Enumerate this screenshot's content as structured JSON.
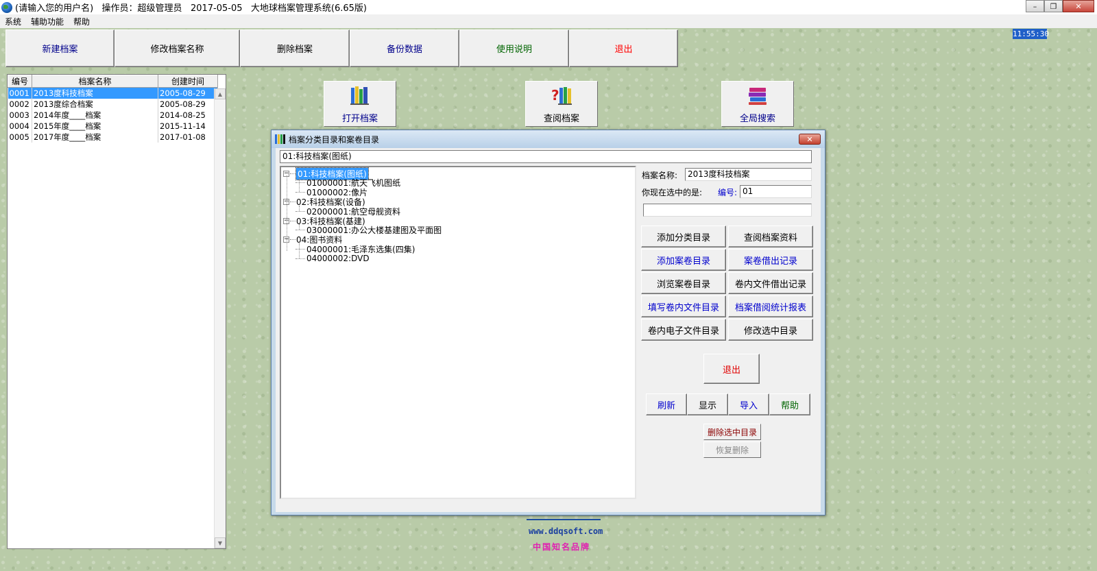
{
  "window": {
    "title": "(请输入您的用户名)   操作员：超级管理员   2017-05-05   大地球档案管理系统(6.65版)"
  },
  "menu": [
    "系统",
    "辅助功能",
    "帮助"
  ],
  "clock": "11:55:30",
  "toolbar": [
    {
      "label": "新建档案",
      "color": "#00008b"
    },
    {
      "label": "修改档案名称",
      "color": "#000000"
    },
    {
      "label": "删除档案",
      "color": "#000000"
    },
    {
      "label": "备份数据",
      "color": "#00008b"
    },
    {
      "label": "使用说明",
      "color": "#006400"
    },
    {
      "label": "退出",
      "color": "#ff0000"
    }
  ],
  "archive_list": {
    "columns": [
      "编号",
      "档案名称",
      "创建时间"
    ],
    "rows": [
      {
        "id": "0001",
        "name": "2013度科技档案",
        "date": "2005-08-29"
      },
      {
        "id": "0002",
        "name": "2013度综合档案",
        "date": "2005-08-29"
      },
      {
        "id": "0003",
        "name": "2014年度____档案",
        "date": "2014-08-25"
      },
      {
        "id": "0004",
        "name": "2015年度____档案",
        "date": "2015-11-14"
      },
      {
        "id": "0005",
        "name": "2017年度____档案",
        "date": "2017-01-08"
      }
    ],
    "selected_index": 0
  },
  "icon_buttons": [
    {
      "label": "打开档案",
      "icon": "books-icon",
      "color": "#00008b"
    },
    {
      "label": "查阅档案",
      "icon": "books-question-icon",
      "color": "#000000"
    },
    {
      "label": "全局搜索",
      "icon": "stacked-books-icon",
      "color": "#00008b"
    }
  ],
  "footer": {
    "url": "www.ddqsoft.com",
    "brand": "中国知名品牌"
  },
  "dialog": {
    "title": "档案分类目录和案卷目录",
    "close": "✕",
    "path": "01:科技档案(图纸)",
    "tree": [
      {
        "text": "01:科技档案(图纸)",
        "level": 0,
        "expander": "−",
        "selected": true
      },
      {
        "text": "01000001:航天飞机图纸",
        "level": 1
      },
      {
        "text": "01000002:像片",
        "level": 1
      },
      {
        "text": "02:科技档案(设备)",
        "level": 0,
        "expander": "−"
      },
      {
        "text": "02000001:航空母舰资料",
        "level": 1
      },
      {
        "text": "03:科技档案(基建)",
        "level": 0,
        "expander": "−"
      },
      {
        "text": "03000001:办公大楼基建图及平面图",
        "level": 1
      },
      {
        "text": "04:图书资料",
        "level": 0,
        "expander": "−"
      },
      {
        "text": "04000001:毛泽东选集(四集)",
        "level": 1
      },
      {
        "text": "04000002:DVD",
        "level": 1
      }
    ],
    "archive_name_label": "档案名称:",
    "archive_name_value": "2013度科技档案",
    "selected_label": "你现在选中的是:",
    "code_label": "编号:",
    "code_value": "01",
    "name_field_value": "",
    "action_buttons": [
      {
        "label": "添加分类目录",
        "color": "#000000"
      },
      {
        "label": "查阅档案资料",
        "color": "#000000"
      },
      {
        "label": "添加案卷目录",
        "color": "#0000cd"
      },
      {
        "label": "案卷借出记录",
        "color": "#0000cd"
      },
      {
        "label": "浏览案卷目录",
        "color": "#000000"
      },
      {
        "label": "卷内文件借出记录",
        "color": "#000000"
      },
      {
        "label": "填写卷内文件目录",
        "color": "#0000cd"
      },
      {
        "label": "档案借阅统计报表",
        "color": "#0000cd"
      },
      {
        "label": "卷内电子文件目录",
        "color": "#000000"
      },
      {
        "label": "修改选中目录",
        "color": "#000000"
      }
    ],
    "exit_label": "退出",
    "small_buttons": [
      {
        "label": "刷新",
        "color": "#0000cd"
      },
      {
        "label": "显示",
        "color": "#000000"
      },
      {
        "label": "导入",
        "color": "#0000cd"
      },
      {
        "label": "帮助",
        "color": "#006400"
      }
    ],
    "delete_selected_label": "删除选中目录",
    "restore_delete_label": "恢复删除"
  }
}
